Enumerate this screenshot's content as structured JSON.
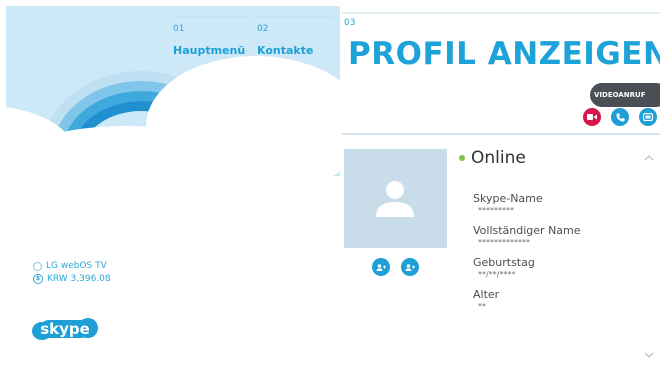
{
  "breadcrumb": [
    {
      "num": "01",
      "label": "Hauptmenü"
    },
    {
      "num": "02",
      "label": "Kontakte"
    },
    {
      "num": "03",
      "label": ""
    }
  ],
  "page_title": "PROFIL ANZEIGEN",
  "account": {
    "device": "LG webOS TV",
    "balance": "KRW 3,396.08",
    "logo_text": "skype"
  },
  "actions": {
    "tooltip": "VIDEOANRUF",
    "buttons": [
      {
        "name": "video-call",
        "icon": "video-camera-icon",
        "color": "#d6174d"
      },
      {
        "name": "voice-call",
        "icon": "phone-icon",
        "color": "#1e9fd6"
      },
      {
        "name": "call-phone",
        "icon": "dialpad-icon",
        "color": "#1e9fd6"
      }
    ]
  },
  "profile": {
    "status": "Online",
    "status_color": "#7ec14a",
    "fields": [
      {
        "label": "Skype-Name",
        "value": "*********"
      },
      {
        "label": "Vollständiger Name",
        "value": "*************"
      },
      {
        "label": "Geburtstag",
        "value": "**/**/****"
      },
      {
        "label": "Alter",
        "value": "**"
      }
    ]
  },
  "colors": {
    "accent": "#1e9fd6",
    "sky": "#cde8f6"
  }
}
